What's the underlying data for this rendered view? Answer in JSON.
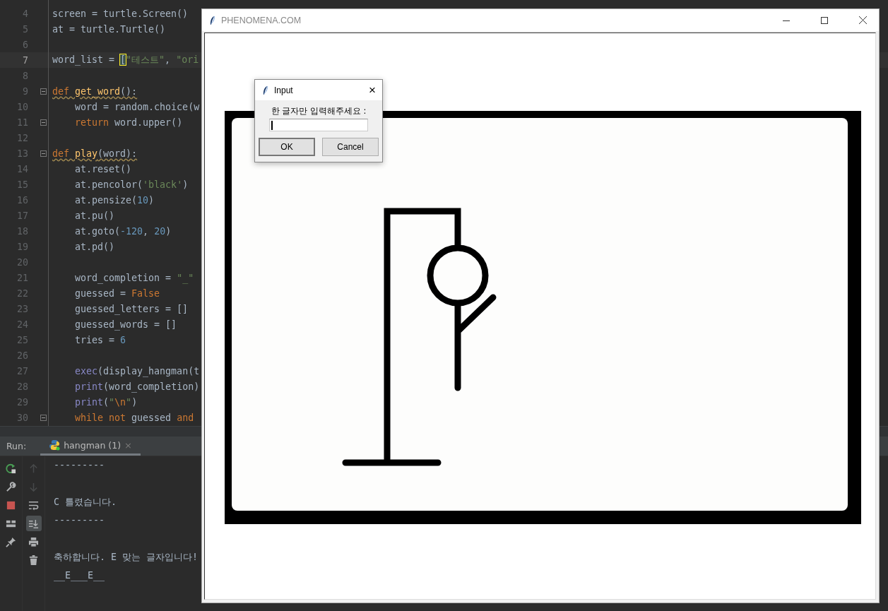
{
  "editor": {
    "lines": [
      {
        "number": "4",
        "current": false,
        "fold": false,
        "warning": false,
        "tokens": [
          {
            "kind": "plain",
            "text": "screen = turtle.Screen()"
          }
        ]
      },
      {
        "number": "5",
        "current": false,
        "fold": false,
        "warning": false,
        "tokens": [
          {
            "kind": "plain",
            "text": "at = turtle.Turtle()"
          }
        ]
      },
      {
        "number": "6",
        "current": false,
        "fold": false
      },
      {
        "number": "7",
        "current": true,
        "fold": false,
        "warning": false,
        "tokens": [
          {
            "kind": "plain",
            "text": "word_list = "
          },
          {
            "kind": "match",
            "text": "["
          },
          {
            "kind": "str",
            "text": "\"테스트\""
          },
          {
            "kind": "plain",
            "text": ", "
          },
          {
            "kind": "str",
            "text": "\"ori"
          }
        ]
      },
      {
        "number": "8",
        "current": false,
        "fold": false
      },
      {
        "number": "9",
        "current": false,
        "fold": true,
        "warning": true,
        "tokens": [
          {
            "kind": "kw",
            "text": "def "
          },
          {
            "kind": "fn",
            "text": "get_word"
          },
          {
            "kind": "plain",
            "text": "():"
          }
        ]
      },
      {
        "number": "10",
        "current": false,
        "fold": false,
        "warning": false,
        "tokens": [
          {
            "kind": "plain",
            "text": "    word = random.choice(w"
          }
        ]
      },
      {
        "number": "11",
        "current": false,
        "fold": true,
        "warning": false,
        "tokens": [
          {
            "kind": "kw",
            "text": "    return"
          },
          {
            "kind": "plain",
            "text": " word.upper()"
          }
        ]
      },
      {
        "number": "12",
        "current": false,
        "fold": false
      },
      {
        "number": "13",
        "current": false,
        "fold": true,
        "warning": true,
        "tokens": [
          {
            "kind": "kw",
            "text": "def "
          },
          {
            "kind": "fn",
            "text": "play"
          },
          {
            "kind": "plain",
            "text": "(word):"
          }
        ]
      },
      {
        "number": "14",
        "current": false,
        "fold": false,
        "warning": false,
        "tokens": [
          {
            "kind": "plain",
            "text": "    at.reset()"
          }
        ]
      },
      {
        "number": "15",
        "current": false,
        "fold": false,
        "warning": false,
        "tokens": [
          {
            "kind": "plain",
            "text": "    at.pencolor("
          },
          {
            "kind": "str",
            "text": "'black'"
          },
          {
            "kind": "plain",
            "text": ")"
          }
        ]
      },
      {
        "number": "16",
        "current": false,
        "fold": false,
        "warning": false,
        "tokens": [
          {
            "kind": "plain",
            "text": "    at.pensize("
          },
          {
            "kind": "num",
            "text": "10"
          },
          {
            "kind": "plain",
            "text": ")"
          }
        ]
      },
      {
        "number": "17",
        "current": false,
        "fold": false,
        "warning": false,
        "tokens": [
          {
            "kind": "plain",
            "text": "    at.pu()"
          }
        ]
      },
      {
        "number": "18",
        "current": false,
        "fold": false,
        "warning": false,
        "tokens": [
          {
            "kind": "plain",
            "text": "    at.goto("
          },
          {
            "kind": "num",
            "text": "-120"
          },
          {
            "kind": "plain",
            "text": ", "
          },
          {
            "kind": "num",
            "text": "20"
          },
          {
            "kind": "plain",
            "text": ")"
          }
        ]
      },
      {
        "number": "19",
        "current": false,
        "fold": false,
        "warning": false,
        "tokens": [
          {
            "kind": "plain",
            "text": "    at.pd()"
          }
        ]
      },
      {
        "number": "20",
        "current": false,
        "fold": false
      },
      {
        "number": "21",
        "current": false,
        "fold": false,
        "warning": false,
        "tokens": [
          {
            "kind": "plain",
            "text": "    word_completion = "
          },
          {
            "kind": "str",
            "text": "\"_\""
          }
        ]
      },
      {
        "number": "22",
        "current": false,
        "fold": false,
        "warning": false,
        "tokens": [
          {
            "kind": "plain",
            "text": "    guessed = "
          },
          {
            "kind": "kw",
            "text": "False"
          }
        ]
      },
      {
        "number": "23",
        "current": false,
        "fold": false,
        "warning": false,
        "tokens": [
          {
            "kind": "plain",
            "text": "    guessed_letters = []"
          }
        ]
      },
      {
        "number": "24",
        "current": false,
        "fold": false,
        "warning": false,
        "tokens": [
          {
            "kind": "plain",
            "text": "    guessed_words = []"
          }
        ]
      },
      {
        "number": "25",
        "current": false,
        "fold": false,
        "warning": false,
        "tokens": [
          {
            "kind": "plain",
            "text": "    tries = "
          },
          {
            "kind": "num",
            "text": "6"
          }
        ]
      },
      {
        "number": "26",
        "current": false,
        "fold": false
      },
      {
        "number": "27",
        "current": false,
        "fold": false,
        "warning": false,
        "tokens": [
          {
            "kind": "builtin",
            "text": "    exec"
          },
          {
            "kind": "plain",
            "text": "(display_hangman(t"
          }
        ]
      },
      {
        "number": "28",
        "current": false,
        "fold": false,
        "warning": false,
        "tokens": [
          {
            "kind": "builtin",
            "text": "    print"
          },
          {
            "kind": "plain",
            "text": "(word_completion)"
          }
        ]
      },
      {
        "number": "29",
        "current": false,
        "fold": false,
        "warning": false,
        "tokens": [
          {
            "kind": "builtin",
            "text": "    print"
          },
          {
            "kind": "plain",
            "text": "("
          },
          {
            "kind": "str",
            "text": "\""
          },
          {
            "kind": "esc",
            "text": "\\n"
          },
          {
            "kind": "str",
            "text": "\""
          },
          {
            "kind": "plain",
            "text": ")"
          }
        ]
      },
      {
        "number": "30",
        "current": false,
        "fold": true,
        "warning": false,
        "tokens": [
          {
            "kind": "kw",
            "text": "    while not"
          },
          {
            "kind": "plain",
            "text": " guessed "
          },
          {
            "kind": "kw",
            "text": "and"
          }
        ]
      }
    ]
  },
  "run": {
    "label": "Run:",
    "tabs": [
      {
        "label": "hangman (1)",
        "close": "×",
        "selected": true
      }
    ],
    "tools_left": [
      {
        "kind": "rerun",
        "disabled": false
      },
      {
        "kind": "wrench",
        "disabled": false
      },
      {
        "kind": "stop",
        "disabled": false
      },
      {
        "kind": "layout",
        "disabled": false
      },
      {
        "kind": "pin",
        "disabled": false
      }
    ],
    "tools_right": [
      {
        "kind": "up",
        "on": false,
        "disabled": true
      },
      {
        "kind": "down",
        "on": false,
        "disabled": true
      },
      {
        "kind": "wrap",
        "on": false,
        "disabled": false
      },
      {
        "kind": "scroll-end",
        "on": true,
        "disabled": false
      },
      {
        "kind": "print",
        "on": false,
        "disabled": false
      },
      {
        "kind": "trash",
        "on": false,
        "disabled": false
      }
    ],
    "output": [
      {
        "kind": "text",
        "text": "---------"
      },
      {
        "kind": "blank"
      },
      {
        "kind": "text",
        "text": "C 틀렸습니다."
      },
      {
        "kind": "text",
        "text": "---------"
      },
      {
        "kind": "blank"
      },
      {
        "kind": "text",
        "text": "축하합니다. E 맞는 글자입니다!"
      },
      {
        "kind": "text",
        "text": "__E___E__"
      }
    ]
  },
  "turtle_window": {
    "title": "PHENOMENA.COM"
  },
  "dialog": {
    "title": "Input",
    "close": "×",
    "prompt": "한 글자만 입력해주세요 :",
    "buttons": [
      {
        "label": "OK",
        "default": true
      },
      {
        "label": "Cancel",
        "default": false
      }
    ]
  }
}
